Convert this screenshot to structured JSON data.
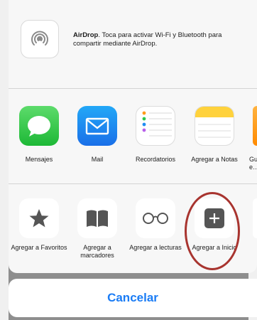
{
  "airdrop": {
    "title": "AirDrop",
    "text": ". Toca para activar Wi-Fi y Bluetooth para compartir mediante AirDrop.",
    "icon": "airdrop-icon"
  },
  "apps": [
    {
      "label": "Mensajes",
      "icon": "messages-icon",
      "color": "#2cc84a"
    },
    {
      "label": "Mail",
      "icon": "mail-icon",
      "color": "#1f8df2"
    },
    {
      "label": "Recordatorios",
      "icon": "reminders-icon",
      "color": "#ffffff"
    },
    {
      "label": "Agregar a Notas",
      "icon": "notes-icon",
      "color": "#ffd23c"
    },
    {
      "label": "Gu… e…",
      "icon": "app-icon",
      "color": "#ff9a1a"
    }
  ],
  "actions": [
    {
      "label": "Agregar a Favoritos",
      "icon": "star-icon"
    },
    {
      "label": "Agregar a marcadores",
      "icon": "book-icon"
    },
    {
      "label": "Agregar a lecturas",
      "icon": "glasses-icon"
    },
    {
      "label": "Agregar a Inicio",
      "icon": "add-to-home-icon"
    }
  ],
  "cancel_label": "Cancelar",
  "colors": {
    "accent": "#1a7cf5",
    "highlight_circle": "#a8342f"
  }
}
